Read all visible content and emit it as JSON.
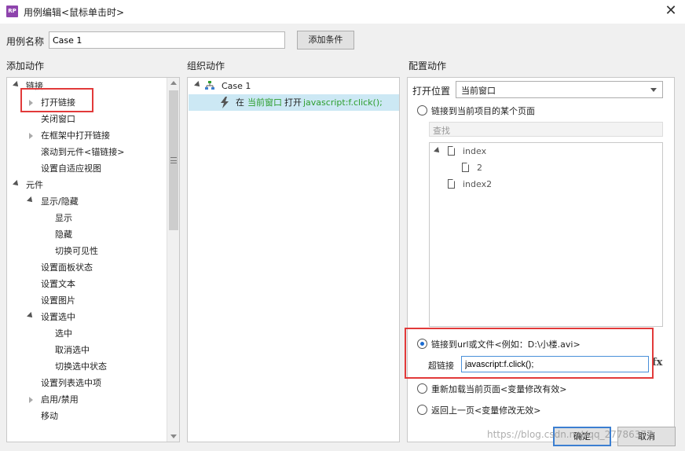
{
  "window": {
    "title": "用例编辑<鼠标单击时>",
    "app_icon_text": "RP",
    "close_glyph": "✕"
  },
  "case": {
    "name_label": "用例名称",
    "name_value": "Case 1",
    "add_condition_label": "添加条件"
  },
  "sections": {
    "add_action": "添加动作",
    "organize_action": "组织动作",
    "configure_action": "配置动作"
  },
  "left_tree": [
    {
      "label": "链接"
    },
    {
      "label": "打开链接"
    },
    {
      "label": "关闭窗口"
    },
    {
      "label": "在框架中打开链接"
    },
    {
      "label": "滚动到元件<锚链接>"
    },
    {
      "label": "设置自适应视图"
    },
    {
      "label": "元件"
    },
    {
      "label": "显示/隐藏"
    },
    {
      "label": "显示"
    },
    {
      "label": "隐藏"
    },
    {
      "label": "切换可见性"
    },
    {
      "label": "设置面板状态"
    },
    {
      "label": "设置文本"
    },
    {
      "label": "设置图片"
    },
    {
      "label": "设置选中"
    },
    {
      "label": "选中"
    },
    {
      "label": "取消选中"
    },
    {
      "label": "切换选中状态"
    },
    {
      "label": "设置列表选中项"
    },
    {
      "label": "启用/禁用"
    },
    {
      "label": "移动"
    }
  ],
  "mid": {
    "case_label": "Case 1",
    "action_prefix": "在",
    "action_target": "当前窗口",
    "action_verb": "打开",
    "action_url": "javascript:f.click();"
  },
  "right": {
    "open_position_label": "打开位置",
    "open_position_value": "当前窗口",
    "radio_page": "链接到当前项目的某个页面",
    "search_placeholder": "查找",
    "pages": {
      "index": "index",
      "child": "2",
      "index2": "index2"
    },
    "radio_url": "链接到url或文件<例如：D:\\小楼.avi>",
    "url_label": "超链接",
    "url_value": "javascript:f.click();",
    "fx": "fx",
    "radio_reload": "重新加载当前页面<变量修改有效>",
    "radio_back": "返回上一页<变量修改无效>"
  },
  "buttons": {
    "ok": "确定",
    "cancel": "取消"
  },
  "watermark": "https://blog.csdn.net/qq_27786377",
  "colors": {
    "highlight_row": "#cce8f4",
    "red_annotation": "#e23a3a",
    "green_text": "#2e9e2e",
    "app_icon": "#8e44ad"
  }
}
